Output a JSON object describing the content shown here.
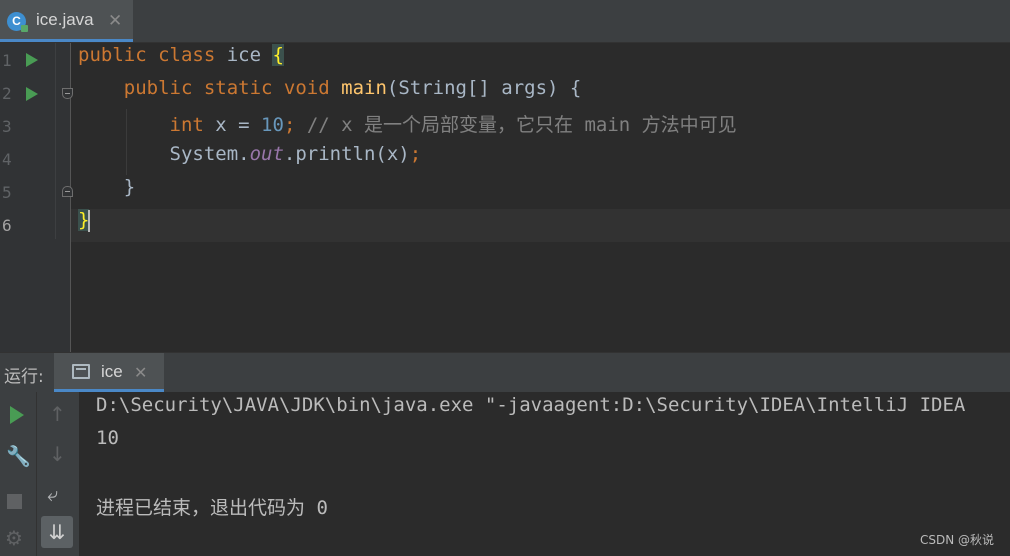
{
  "editor_tab": {
    "file_name": "ice.java",
    "close": "✕",
    "icon": "java-class-icon"
  },
  "gutter": {
    "line_numbers": [
      "1",
      "2",
      "3",
      "4",
      "5",
      "6"
    ]
  },
  "code": {
    "line1": {
      "kw": "public class",
      "name": " ice ",
      "brace": "{"
    },
    "line2": {
      "indent": "    ",
      "kw": "public static void",
      "sp": " ",
      "fn": "main",
      "rest": "(String[] args) {"
    },
    "line3": {
      "indent": "        ",
      "kw": "int",
      "rest": " x = ",
      "num": "10",
      "semi": ";",
      "comment": " // x 是一个局部变量，它只在 main 方法中可见"
    },
    "line4": {
      "indent": "        ",
      "pre": "System.",
      "field": "out",
      "post": ".println(x)",
      "semi": ";"
    },
    "line5": {
      "indent": "    ",
      "text": "}"
    },
    "line6": {
      "brace": "}"
    }
  },
  "run_panel": {
    "title": "运行:",
    "tab_name": "ice",
    "tab_close": "✕",
    "console": [
      "D:\\Security\\JAVA\\JDK\\bin\\java.exe \"-javaagent:D:\\Security\\IDEA\\IntelliJ IDEA",
      "10",
      "",
      "进程已结束，退出代码为 0"
    ]
  },
  "watermark": "CSDN @秋说",
  "colors": {
    "keyword": "#cc7832",
    "function": "#ffc66d",
    "number": "#6897bb",
    "comment": "#808080",
    "run_green": "#499c54",
    "accent": "#4a88c7"
  }
}
